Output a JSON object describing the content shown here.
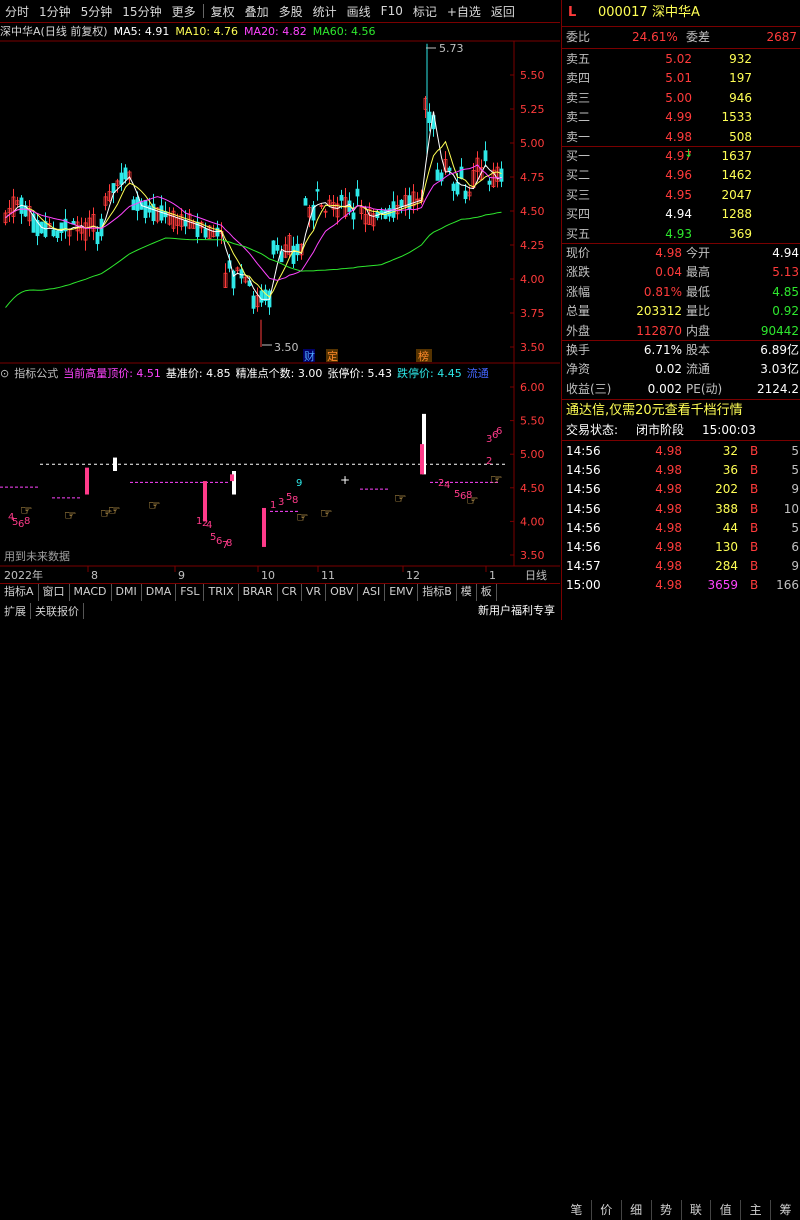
{
  "toolbar": {
    "items": [
      "分时",
      "1分钟",
      "5分钟",
      "15分钟",
      "更多",
      "复权",
      "叠加",
      "多股",
      "统计",
      "画线",
      "F10",
      "标记",
      "+自选",
      "返回"
    ]
  },
  "chart_title": {
    "stock": "深中华A(日线 前复权)",
    "ma5": "MA5: 4.91",
    "ma10": "MA10: 4.76",
    "ma20": "MA20: 4.82",
    "ma60": "MA60: 4.56"
  },
  "main_axis": {
    "labels": [
      "5.50",
      "5.25",
      "5.00",
      "4.75",
      "4.50",
      "4.25",
      "4.00",
      "3.75",
      "3.50"
    ]
  },
  "main_annotations": {
    "high": "5.73",
    "low": "3.50",
    "marker1": "财",
    "marker2": "定",
    "marker3": "榜"
  },
  "indicator_title": {
    "name": "指标公式",
    "top_price": "当前高量顶价: 4.51",
    "base_price": "基准价: 4.85",
    "precision": "精准点个数: 3.00",
    "limit_up": "张停价: 5.43",
    "limit_down": "跌停价: 4.45",
    "flow": "流通"
  },
  "indicator_axis": {
    "labels": [
      "6.00",
      "5.50",
      "5.00",
      "4.50",
      "4.00",
      "3.50"
    ]
  },
  "future_data_note": "用到未来数据",
  "x_axis": {
    "year": "2022年",
    "months": [
      "8",
      "9",
      "10",
      "11",
      "12",
      "1"
    ],
    "right_label": "日线"
  },
  "bottom_tabs": [
    "指标A",
    "窗口",
    "MACD",
    "DMI",
    "DMA",
    "FSL",
    "TRIX",
    "BRAR",
    "CR",
    "VR",
    "OBV",
    "ASI",
    "EMV",
    "指标B",
    "模",
    "板"
  ],
  "bottom_tabs2": [
    "扩展",
    "关联报价"
  ],
  "quote": {
    "code": "000017",
    "name": "深中华A",
    "marker": "L",
    "weibi_label": "委比",
    "weibi": "24.61%",
    "weicha_label": "委差",
    "weicha": "2687",
    "asks": [
      {
        "label": "卖五",
        "price": "5.02",
        "vol": "932"
      },
      {
        "label": "卖四",
        "price": "5.01",
        "vol": "197"
      },
      {
        "label": "卖三",
        "price": "5.00",
        "vol": "946"
      },
      {
        "label": "卖二",
        "price": "4.99",
        "vol": "1533"
      },
      {
        "label": "卖一",
        "price": "4.98",
        "vol": "508"
      }
    ],
    "bids": [
      {
        "label": "买一",
        "price": "4.97",
        "vol": "1637"
      },
      {
        "label": "买二",
        "price": "4.96",
        "vol": "1462"
      },
      {
        "label": "买三",
        "price": "4.95",
        "vol": "2047"
      },
      {
        "label": "买四",
        "price": "4.94",
        "vol": "1288"
      },
      {
        "label": "买五",
        "price": "4.93",
        "vol": "369"
      }
    ],
    "stats": [
      {
        "l1": "现价",
        "v1": "4.98",
        "l2": "今开",
        "v2": "4.94"
      },
      {
        "l1": "涨跌",
        "v1": "0.04",
        "l2": "最高",
        "v2": "5.13"
      },
      {
        "l1": "涨幅",
        "v1": "0.81%",
        "l2": "最低",
        "v2": "4.85"
      },
      {
        "l1": "总量",
        "v1": "203312",
        "l2": "量比",
        "v2": "0.92"
      },
      {
        "l1": "外盘",
        "v1": "112870",
        "l2": "内盘",
        "v2": "90442"
      }
    ],
    "stats2": [
      {
        "l1": "换手",
        "v1": "6.71%",
        "l2": "股本",
        "v2": "6.89亿"
      },
      {
        "l1": "净资",
        "v1": "0.02",
        "l2": "流通",
        "v2": "3.03亿"
      },
      {
        "l1": "收益(三)",
        "v1": "0.002",
        "l2": "PE(动)",
        "v2": "2124.2"
      }
    ],
    "promo": "通达信,仅需20元查看千档行情",
    "trade_status_label": "交易状态:",
    "trade_status": "闭市阶段",
    "trade_time": "15:00:03",
    "ticks": [
      {
        "t": "14:56",
        "p": "4.98",
        "v": "32",
        "s": "B",
        "n": "5"
      },
      {
        "t": "14:56",
        "p": "4.98",
        "v": "36",
        "s": "B",
        "n": "5"
      },
      {
        "t": "14:56",
        "p": "4.98",
        "v": "202",
        "s": "B",
        "n": "9"
      },
      {
        "t": "14:56",
        "p": "4.98",
        "v": "388",
        "s": "B",
        "n": "10"
      },
      {
        "t": "14:56",
        "p": "4.98",
        "v": "44",
        "s": "B",
        "n": "5"
      },
      {
        "t": "14:56",
        "p": "4.98",
        "v": "130",
        "s": "B",
        "n": "6"
      },
      {
        "t": "14:57",
        "p": "4.98",
        "v": "284",
        "s": "B",
        "n": "9"
      },
      {
        "t": "15:00",
        "p": "4.98",
        "v": "3659",
        "s": "B",
        "n": "166"
      }
    ],
    "bottom_tabs": [
      "笔",
      "价",
      "细",
      "势",
      "联",
      "值",
      "主",
      "筹"
    ],
    "promo2": "新用户福利专享"
  },
  "colors": {
    "up": "#ff3b3b",
    "down": "#2ee82e",
    "ma5": "#ffffff",
    "ma10": "#ffff55",
    "ma20": "#ff44ff",
    "ma60": "#2ee82e",
    "axis": "#7a0000"
  }
}
